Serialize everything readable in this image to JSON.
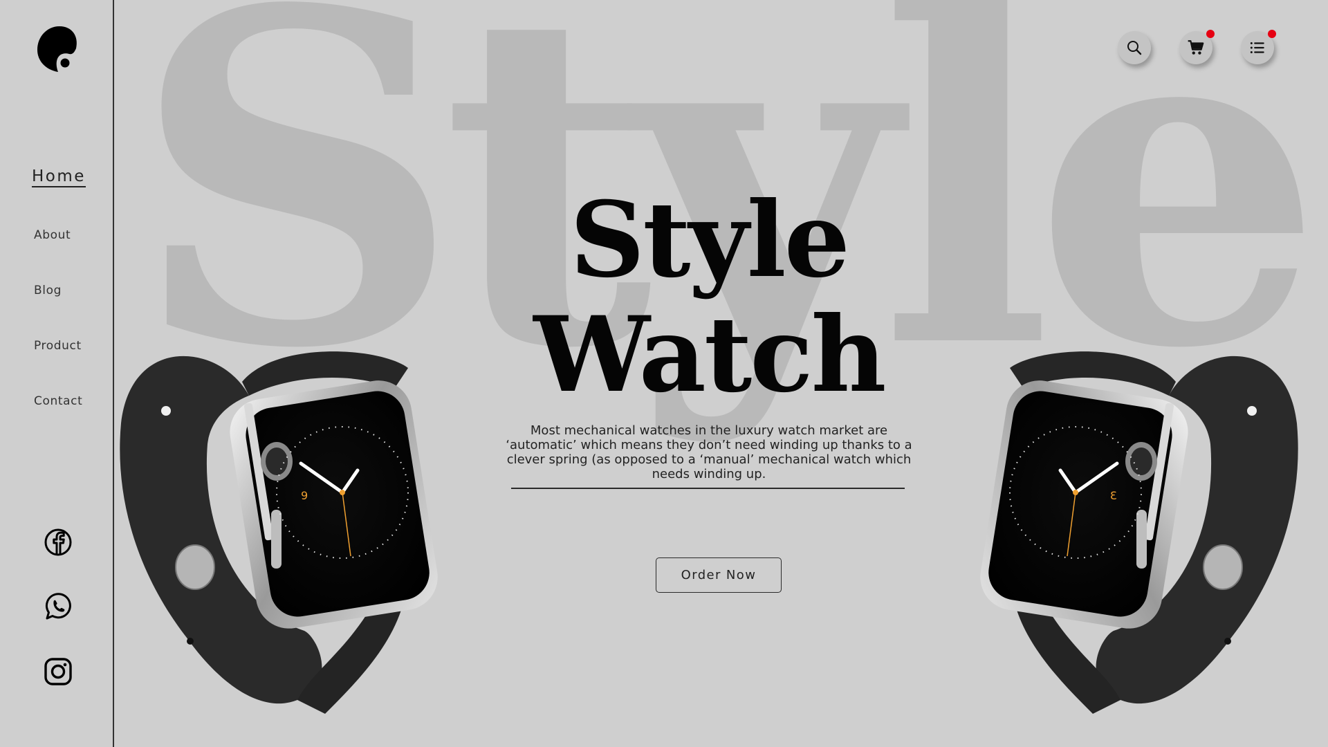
{
  "hero": {
    "background_word": "Style",
    "title_line1": "Style",
    "title_line2": "Watch",
    "description": "Most mechanical watches in the luxury watch market are ‘automatic’ which means they don’t need winding up thanks to a clever spring (as opposed to a ‘manual’ mechanical watch which needs winding up.",
    "order_button": "Order Now"
  },
  "nav": {
    "items": [
      {
        "label": "Home",
        "active": true
      },
      {
        "label": "About"
      },
      {
        "label": "Blog"
      },
      {
        "label": "Product"
      },
      {
        "label": "Contact"
      }
    ]
  },
  "social": [
    "facebook-icon",
    "whatsapp-icon",
    "instagram-icon"
  ],
  "header_icons": [
    "search-icon",
    "cart-icon",
    "menu-list-icon"
  ],
  "notification_badges": [
    "cart",
    "menu"
  ],
  "watch_face_numerals": [
    "9",
    "3"
  ],
  "colors": {
    "background": "#cfcfcf",
    "background_word": "#b9b9b9",
    "text": "#111111",
    "badge": "#e60012",
    "second_hand": "#f0a030"
  }
}
